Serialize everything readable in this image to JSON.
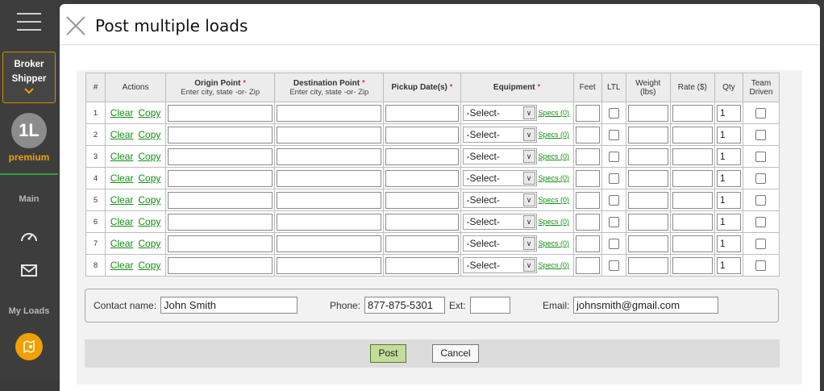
{
  "sidebar": {
    "role_lines": [
      "Broker",
      "Shipper"
    ],
    "avatar_initials": "1L",
    "plan": "premium",
    "section_main": "Main",
    "section_my_loads": "My Loads",
    "icons": [
      "hamburger-icon",
      "chevron-down-icon",
      "dashboard-gauge-icon",
      "mail-icon",
      "map-pin-icon"
    ]
  },
  "modal": {
    "title": "Post multiple loads"
  },
  "table": {
    "headers": {
      "num": "#",
      "actions": "Actions",
      "origin": "Origin Point",
      "origin_hint": "Enter city, state -or- Zip",
      "destination": "Destination Point",
      "destination_hint": "Enter city, state -or- Zip",
      "pickup": "Pickup Date(s)",
      "equipment": "Equipment",
      "feet": "Feet",
      "ltl": "LTL",
      "weight": "Weight (lbs)",
      "rate": "Rate ($)",
      "qty": "Qty",
      "team": "Team Driven",
      "required_mark": "*"
    },
    "rows": [
      {
        "num": "1",
        "clear": "Clear",
        "copy": "Copy",
        "equipment": "-Select-",
        "specs": "Specs (0)",
        "qty": "1"
      },
      {
        "num": "2",
        "clear": "Clear",
        "copy": "Copy",
        "equipment": "-Select-",
        "specs": "Specs (0)",
        "qty": "1"
      },
      {
        "num": "3",
        "clear": "Clear",
        "copy": "Copy",
        "equipment": "-Select-",
        "specs": "Specs (0)",
        "qty": "1"
      },
      {
        "num": "4",
        "clear": "Clear",
        "copy": "Copy",
        "equipment": "-Select-",
        "specs": "Specs (0)",
        "qty": "1"
      },
      {
        "num": "5",
        "clear": "Clear",
        "copy": "Copy",
        "equipment": "-Select-",
        "specs": "Specs (0)",
        "qty": "1"
      },
      {
        "num": "6",
        "clear": "Clear",
        "copy": "Copy",
        "equipment": "-Select-",
        "specs": "Specs (0)",
        "qty": "1"
      },
      {
        "num": "7",
        "clear": "Clear",
        "copy": "Copy",
        "equipment": "-Select-",
        "specs": "Specs (0)",
        "qty": "1"
      },
      {
        "num": "8",
        "clear": "Clear",
        "copy": "Copy",
        "equipment": "-Select-",
        "specs": "Specs (0)",
        "qty": "1"
      }
    ]
  },
  "contact": {
    "name_label": "Contact name:",
    "name_value": "John Smith",
    "phone_label": "Phone:",
    "phone_value": "877-875-5301",
    "ext_label": "Ext:",
    "ext_value": "",
    "email_label": "Email:",
    "email_value": "johnsmith@gmail.com"
  },
  "actions": {
    "post": "Post",
    "cancel": "Cancel"
  }
}
